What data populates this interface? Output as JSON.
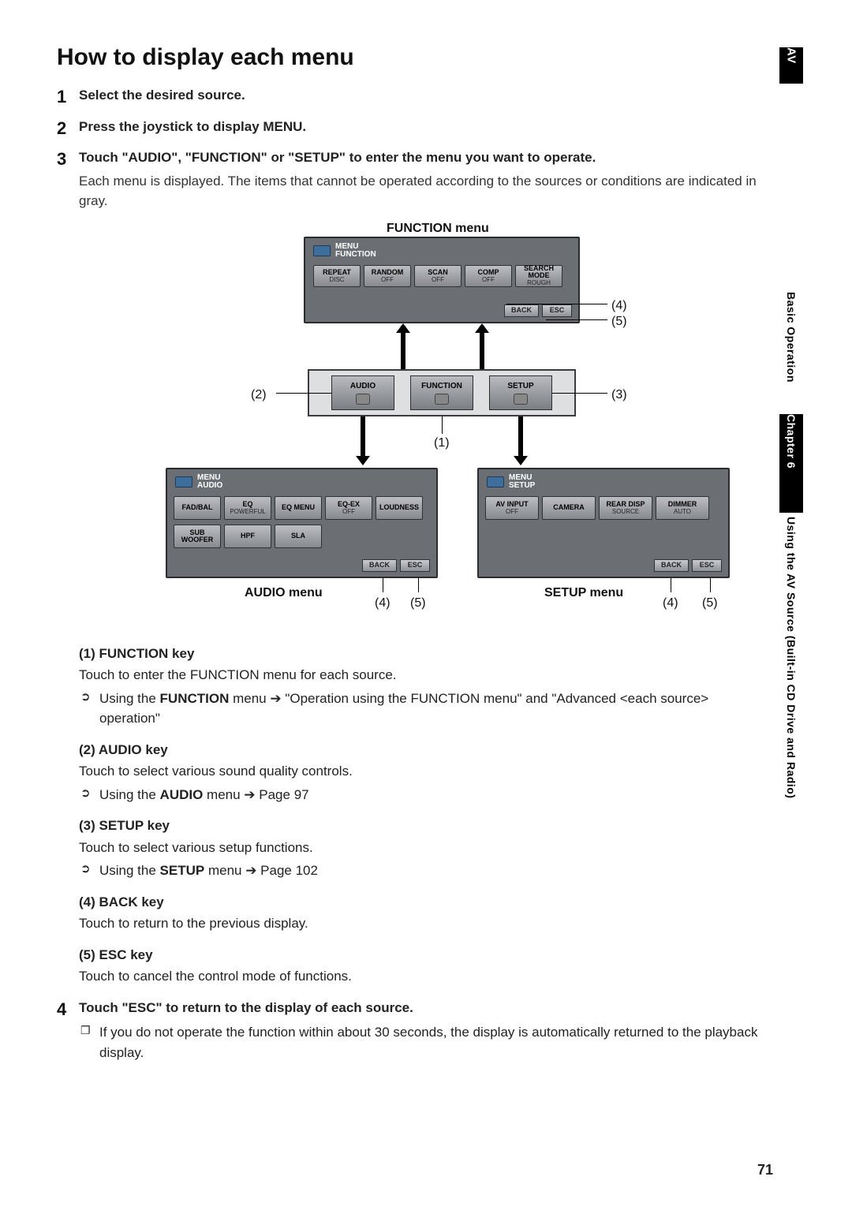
{
  "side": {
    "av": "AV",
    "basic": "Basic Operation",
    "chapter": "Chapter 6",
    "using": "Using the AV Source (Built-in CD Drive and Radio)"
  },
  "title": "How to display each menu",
  "steps": [
    {
      "head": "Select the desired source."
    },
    {
      "head": "Press the joystick to display MENU."
    },
    {
      "head": "Touch \"AUDIO\", \"FUNCTION\" or \"SETUP\" to enter the menu you want to operate.",
      "body": "Each menu is displayed. The items that cannot be operated according to the sources or conditions are indicated in gray."
    },
    {
      "head": "Touch \"ESC\" to return to the display of each source."
    }
  ],
  "diagram": {
    "top_title": "FUNCTION menu",
    "function_screen": {
      "menu_lines": [
        "MENU",
        "FUNCTION"
      ],
      "row1": [
        {
          "l": "REPEAT",
          "s": "DISC"
        },
        {
          "l": "RANDOM",
          "s": "OFF"
        },
        {
          "l": "SCAN",
          "s": "OFF"
        },
        {
          "l": "COMP",
          "s": "OFF"
        },
        {
          "l": "SEARCH MODE",
          "s": "ROUGH"
        }
      ],
      "back": "BACK",
      "esc": "ESC"
    },
    "mid_keys": {
      "audio": "AUDIO",
      "function": "FUNCTION",
      "setup": "SETUP"
    },
    "audio_screen": {
      "menu_lines": [
        "MENU",
        "AUDIO"
      ],
      "row1": [
        {
          "l": "FAD/BAL"
        },
        {
          "l": "EQ",
          "s": "POWERFUL"
        },
        {
          "l": "EQ MENU"
        },
        {
          "l": "EQ-EX",
          "s": "OFF"
        },
        {
          "l": "LOUDNESS"
        }
      ],
      "row2": [
        {
          "l": "SUB WOOFER"
        },
        {
          "l": "HPF"
        },
        {
          "l": "SLA"
        }
      ],
      "back": "BACK",
      "esc": "ESC"
    },
    "setup_screen": {
      "menu_lines": [
        "MENU",
        "SETUP"
      ],
      "row1": [
        {
          "l": "AV INPUT",
          "s": "OFF"
        },
        {
          "l": "CAMERA"
        },
        {
          "l": "REAR DISP",
          "s": "SOURCE"
        },
        {
          "l": "DIMMER",
          "s": "AUTO"
        }
      ],
      "back": "BACK",
      "esc": "ESC"
    },
    "callouts": {
      "c1": "(1)",
      "c2": "(2)",
      "c3": "(3)",
      "c4": "(4)",
      "c5": "(5)"
    },
    "bottom_labels": {
      "audio": "AUDIO menu",
      "setup": "SETUP menu"
    }
  },
  "refs": [
    {
      "hd_num": "(1)",
      "hd": "FUNCTION key",
      "desc": "Touch to enter the FUNCTION menu for each source.",
      "sub_pre": "Using the ",
      "sub_bold": "FUNCTION",
      "sub_post": " menu ➔ \"Operation using the FUNCTION menu\" and \"Advanced <each source> operation\""
    },
    {
      "hd_num": "(2)",
      "hd": "AUDIO key",
      "desc": "Touch to select various sound quality controls.",
      "sub_pre": "Using the ",
      "sub_bold": "AUDIO",
      "sub_post": " menu ➔ Page 97"
    },
    {
      "hd_num": "(3)",
      "hd": "SETUP key",
      "desc": "Touch to select various setup functions.",
      "sub_pre": "Using the ",
      "sub_bold": "SETUP",
      "sub_post": " menu ➔ Page 102"
    },
    {
      "hd_num": "(4)",
      "hd": "BACK key",
      "desc": "Touch to return to the previous display."
    },
    {
      "hd_num": "(5)",
      "hd": "ESC key",
      "desc": "Touch to cancel the control mode of functions."
    }
  ],
  "note4": "If you do not operate the function within about 30 seconds, the display is automatically returned to the playback display.",
  "pagenum": "71"
}
